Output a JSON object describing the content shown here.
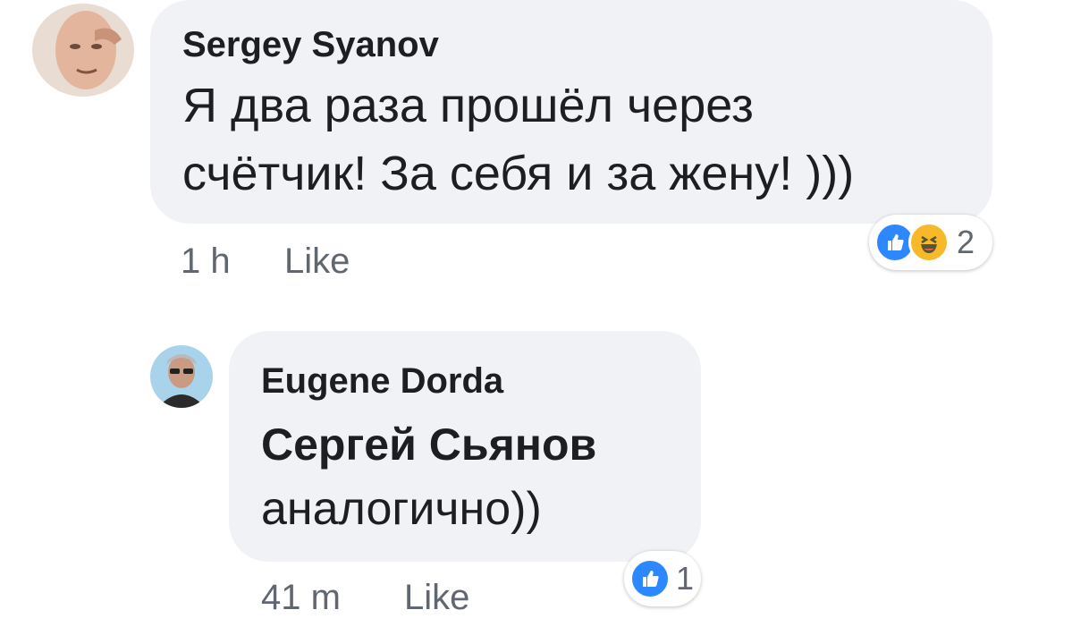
{
  "comments": [
    {
      "author": "Sergey  Syanov",
      "text_line1": "Я два раза прошёл через",
      "text_line2": "счётчик! За себя и за жену! )))",
      "time": "1 h",
      "like_label": "Like",
      "reactions": {
        "icons": [
          "like-icon",
          "haha-icon"
        ],
        "count": "2"
      }
    },
    {
      "author": "Eugene Dorda",
      "mention": "Сергей Сьянов",
      "text": "аналогично))",
      "time": "41 m",
      "like_label": "Like",
      "reactions": {
        "icons": [
          "like-icon"
        ],
        "count": "1"
      }
    }
  ],
  "colors": {
    "bubble": "#f0f2f5",
    "text": "#1c1e21",
    "meta": "#606770",
    "like_blue": "#2d88ff",
    "haha_yellow": "#f7b928"
  }
}
